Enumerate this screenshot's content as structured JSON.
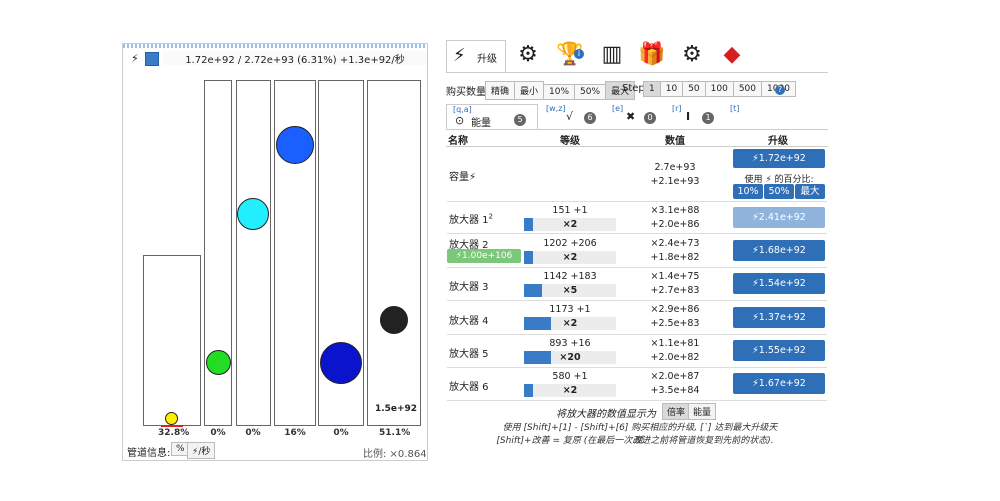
{
  "left": {
    "capacity_text": "1.72e+92 / 2.72e+93 (6.31%) +1.3e+92/秒",
    "bolt": "⚡",
    "tubes": [
      {
        "pct": "32.8%",
        "level": 0.328,
        "color": "#ffee00"
      },
      {
        "pct": "0%",
        "level": 0,
        "color": "#22dd22"
      },
      {
        "pct": "0%",
        "level": 0,
        "color": "#22eeff"
      },
      {
        "pct": "16%",
        "level": 0.16,
        "color": "#1a5fff"
      },
      {
        "pct": "0%",
        "level": 0,
        "color": "#0a14cc"
      },
      {
        "pct": "51.1%",
        "level": 0.511,
        "color": "#222222"
      }
    ],
    "last_tube_value": "1.5e+92",
    "pipe_label": "管道信息:",
    "pipe_btn_pct": "%",
    "pipe_btn_rate": "⚡/秒",
    "ratio": "比例: ×0.864"
  },
  "tabs": {
    "active_label": "升级",
    "icons": [
      "lightning-tab-icon",
      "gear-skull-icon",
      "trophy-icon",
      "stats-icon",
      "gift-icon",
      "settings-icon",
      "ruby-icon"
    ],
    "trophy_badge": "i"
  },
  "buy": {
    "label": "购买数量",
    "options": [
      "精确",
      "最小",
      "10%",
      "50%",
      "最大"
    ],
    "active": "最大",
    "step_label": "Step:",
    "steps": [
      "1",
      "10",
      "50",
      "100",
      "500",
      "1000"
    ],
    "active_step": "1",
    "help": "?"
  },
  "subtabs": [
    {
      "key": "[q,a]",
      "label": "能量",
      "count": "5"
    },
    {
      "key": "[w,z]",
      "label": "",
      "count": "6"
    },
    {
      "key": "[e]",
      "label": "",
      "count": "0"
    },
    {
      "key": "[r]",
      "label": "",
      "count": "1"
    },
    {
      "key": "[t]",
      "label": "",
      "count": ""
    }
  ],
  "table": {
    "headers": [
      "名称",
      "等级",
      "数值",
      "升级"
    ],
    "capacity": {
      "name": "容量⚡",
      "value1": "2.7e+93",
      "value2": "+2.1e+93",
      "btn": "⚡1.72e+92",
      "use_text": "使用 ⚡ 的百分比:",
      "pct_btns": [
        "10%",
        "50%",
        "最大"
      ]
    },
    "rows": [
      {
        "name": "放大器 1",
        "sup": "2",
        "level": "151 +1",
        "mult": "×2",
        "fill": 0.1,
        "v1": "×3.1e+88",
        "v2": "+2.0e+86",
        "btn": "⚡2.41e+92",
        "light": true
      },
      {
        "name": "放大器 2",
        "badge": "⚡1.00e+106",
        "level": "1202 +206",
        "mult": "×2",
        "fill": 0.1,
        "v1": "×2.4e+73",
        "v2": "+1.8e+82",
        "btn": "⚡1.68e+92",
        "light": false
      },
      {
        "name": "放大器 3",
        "level": "1142 +183",
        "mult": "×5",
        "fill": 0.2,
        "v1": "×1.4e+75",
        "v2": "+2.7e+83",
        "btn": "⚡1.54e+92",
        "light": false
      },
      {
        "name": "放大器 4",
        "level": "1173 +1",
        "mult": "×2",
        "fill": 0.3,
        "v1": "×2.9e+86",
        "v2": "+2.5e+83",
        "btn": "⚡1.37e+92",
        "light": false
      },
      {
        "name": "放大器 5",
        "level": "893 +16",
        "mult": "×20",
        "fill": 0.3,
        "v1": "×1.1e+81",
        "v2": "+2.0e+82",
        "btn": "⚡1.55e+92",
        "light": false
      },
      {
        "name": "放大器 6",
        "level": "580 +1",
        "mult": "×2",
        "fill": 0.1,
        "v1": "×2.0e+87",
        "v2": "+3.5e+84",
        "btn": "⚡1.67e+92",
        "light": false
      }
    ]
  },
  "footer": {
    "display_label": "将放大器的数值显示为",
    "display_opts": [
      "倍率",
      "能量"
    ],
    "line1": "使用 [Shift]+[1] - [Shift]+[6] 购买相应的升级, [`] 达到最大升级天赋.",
    "line2": "[Shift]+改善 = 复原 (在最后一次改进之前将管道恢复到先前的状态)."
  }
}
